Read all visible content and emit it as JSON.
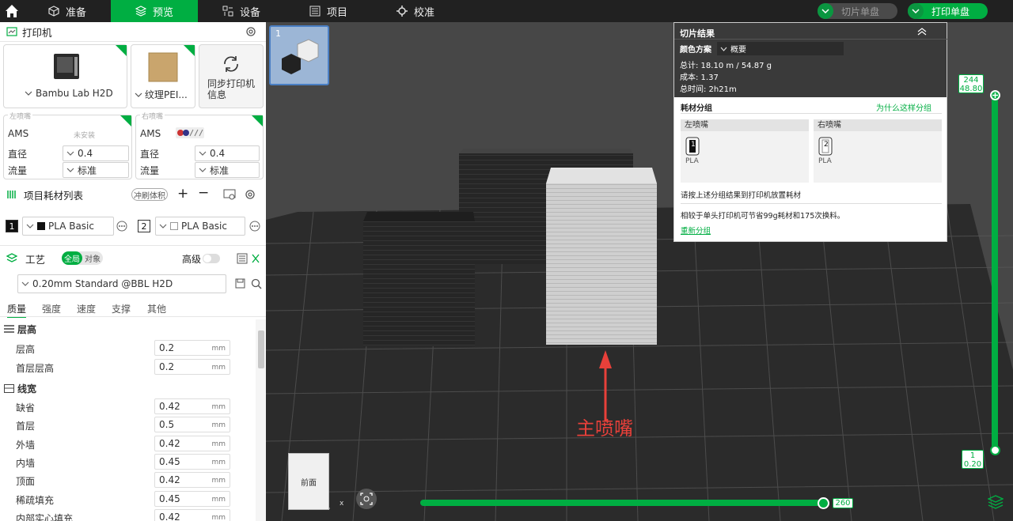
{
  "topbar": {
    "tabs": [
      {
        "label": "准备",
        "icon": "cube-icon"
      },
      {
        "label": "预览",
        "icon": "cubes-icon"
      },
      {
        "label": "设备",
        "icon": "device-icon"
      },
      {
        "label": "项目",
        "icon": "project-icon"
      },
      {
        "label": "校准",
        "icon": "calibrate-icon"
      }
    ],
    "slice_button": "切片单盘",
    "print_button": "打印单盘"
  },
  "printer": {
    "title": "打印机",
    "printer_name": "Bambu Lab H2D",
    "plate_name": "纹理PEI...",
    "sync_label": "同步打印机信息",
    "left_nozzle": {
      "tag": "左喷嘴",
      "ams_label": "AMS",
      "ams_value": "未安装",
      "diameter_label": "直径",
      "diameter": "0.4",
      "flow_label": "流量",
      "flow": "标准"
    },
    "right_nozzle": {
      "tag": "右喷嘴",
      "ams_label": "AMS",
      "diameter_label": "直径",
      "diameter": "0.4",
      "flow_label": "流量",
      "flow": "标准"
    }
  },
  "filaments": {
    "title": "项目耗材列表",
    "flush_button": "冲刷体积",
    "items": [
      {
        "index": "1",
        "name": "PLA Basic",
        "color": "#111111"
      },
      {
        "index": "2",
        "name": "PLA Basic",
        "color": "#ffffff"
      }
    ]
  },
  "process": {
    "title": "工艺",
    "toggle_global": "全局",
    "toggle_object": "对象",
    "advanced_label": "高级",
    "preset": "0.20mm Standard @BBL H2D",
    "subtabs": [
      "质量",
      "强度",
      "速度",
      "支撑",
      "其他"
    ],
    "groups": [
      {
        "title": "层高",
        "rows": [
          {
            "label": "层高",
            "value": "0.2",
            "unit": "mm"
          },
          {
            "label": "首层层高",
            "value": "0.2",
            "unit": "mm"
          }
        ]
      },
      {
        "title": "线宽",
        "rows": [
          {
            "label": "缺省",
            "value": "0.42",
            "unit": "mm"
          },
          {
            "label": "首层",
            "value": "0.5",
            "unit": "mm"
          },
          {
            "label": "外墙",
            "value": "0.42",
            "unit": "mm"
          },
          {
            "label": "内墙",
            "value": "0.45",
            "unit": "mm"
          },
          {
            "label": "顶面",
            "value": "0.42",
            "unit": "mm"
          },
          {
            "label": "稀疏填充",
            "value": "0.45",
            "unit": "mm"
          },
          {
            "label": "内部实心填充",
            "value": "0.42",
            "unit": "mm"
          }
        ]
      }
    ]
  },
  "viewport": {
    "plate_number": "1",
    "annotation": "主喷嘴",
    "view_cube_label": "前面",
    "axis_x": "x",
    "layer_top": "244",
    "layer_top_height": "48.80",
    "layer_bottom": "1",
    "layer_bottom_height": "0.20",
    "move_value": "260"
  },
  "slice_result": {
    "title": "切片结果",
    "color_scheme_label": "颜色方案",
    "color_scheme_value": "概要",
    "total": "总计:  18.10 m / 54.87 g",
    "cost": "成本:  1.37",
    "time": "总时间:  2h21m",
    "group_title": "耗材分组",
    "why_link": "为什么这样分组",
    "left_nozzle": "左喷嘴",
    "right_nozzle": "右喷嘴",
    "left_spool": {
      "index": "1",
      "type": "PLA"
    },
    "right_spool": {
      "index": "2",
      "type": "PLA"
    },
    "instruction": "请按上述分组结果到打印机放置耗材",
    "saving": "相较于单头打印机可节省99g耗材和175次换料。",
    "regroup_link": "重新分组"
  },
  "colors": {
    "accent": "#00ae42",
    "annotation": "#e8403a",
    "dark": "#212121"
  }
}
